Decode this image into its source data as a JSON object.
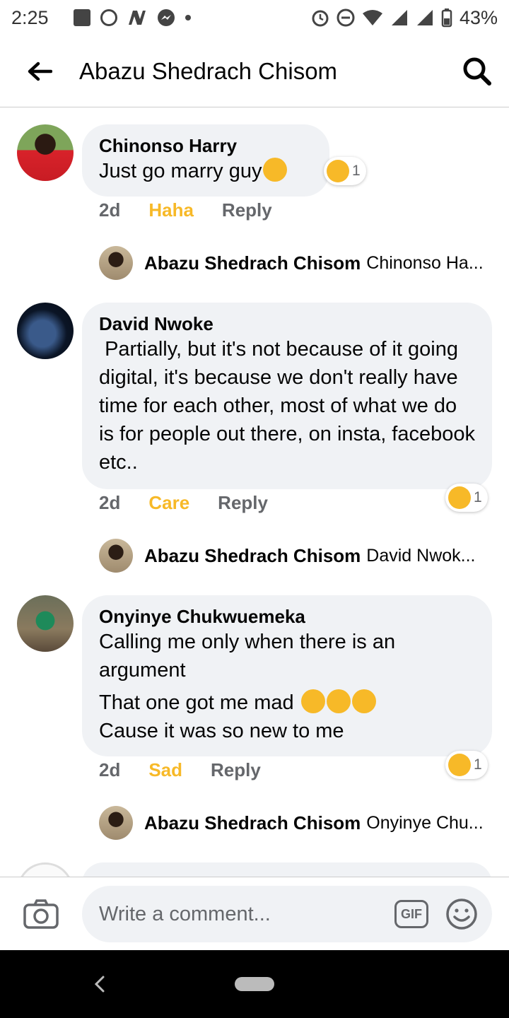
{
  "status_bar": {
    "time": "2:25",
    "battery": "43%"
  },
  "header": {
    "title": "Abazu Shedrach Chisom"
  },
  "comments": [
    {
      "author": "Chinonso Harry",
      "text": "Just go marry guy",
      "time": "2d",
      "reaction_label": "Haha",
      "reply_label": "Reply",
      "reaction_count": "1",
      "reply_preview": {
        "author": "Abazu Shedrach Chisom",
        "snippet": "Chinonso Ha..."
      }
    },
    {
      "author": "David Nwoke",
      "text": " Partially, but it's not because of it going digital, it's because we don't really have time for each other, most of what we do is for people out there, on insta, facebook etc..",
      "time": "2d",
      "reaction_label": "Care",
      "reply_label": "Reply",
      "reaction_count": "1",
      "reply_preview": {
        "author": "Abazu Shedrach Chisom",
        "snippet": "David Nwok..."
      }
    },
    {
      "author": "Onyinye Chukwuemeka",
      "text_line1": "Calling me only when there is an argument",
      "text_line2": "That one got me mad",
      "text_line3": "Cause it was so new to me",
      "time": "2d",
      "reaction_label": "Sad",
      "reply_label": "Reply",
      "reaction_count": "1",
      "reply_preview": {
        "author": "Abazu Shedrach Chisom",
        "snippet": "Onyinye Chu..."
      }
    }
  ],
  "composer": {
    "placeholder": "Write a comment...",
    "gif_label": "GIF"
  },
  "colors": {
    "reaction_text": "#f7b928",
    "bubble_bg": "#f0f2f5",
    "meta_text": "#65676b"
  }
}
